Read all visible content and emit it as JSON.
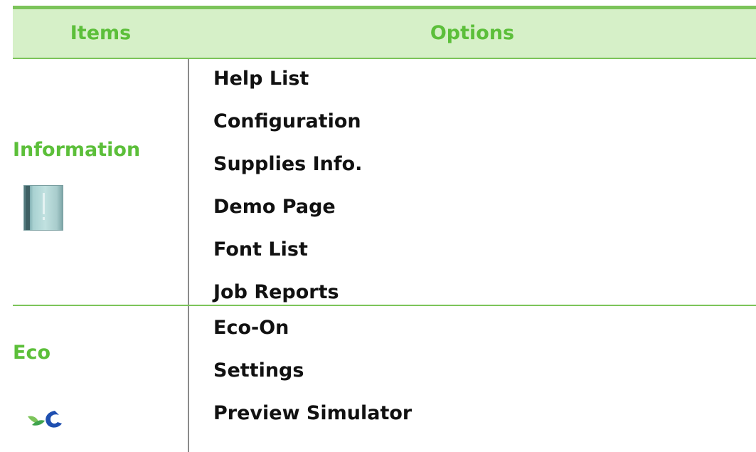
{
  "header": {
    "items": "Items",
    "options": "Options"
  },
  "rows": [
    {
      "item": "Information",
      "icon": "information-book-icon",
      "options": [
        "Help List",
        "Configuration",
        "Supplies Info.",
        "Demo Page",
        "Font List",
        "Job Reports"
      ]
    },
    {
      "item": "Eco",
      "icon": "eco-leaf-icon",
      "options": [
        "Eco-On",
        "Settings",
        "Preview Simulator"
      ]
    }
  ],
  "colors": {
    "accent_green": "#5cbf3a",
    "header_bg": "#d6f0c8",
    "rule_green": "#7cc45a",
    "text": "#111111"
  }
}
